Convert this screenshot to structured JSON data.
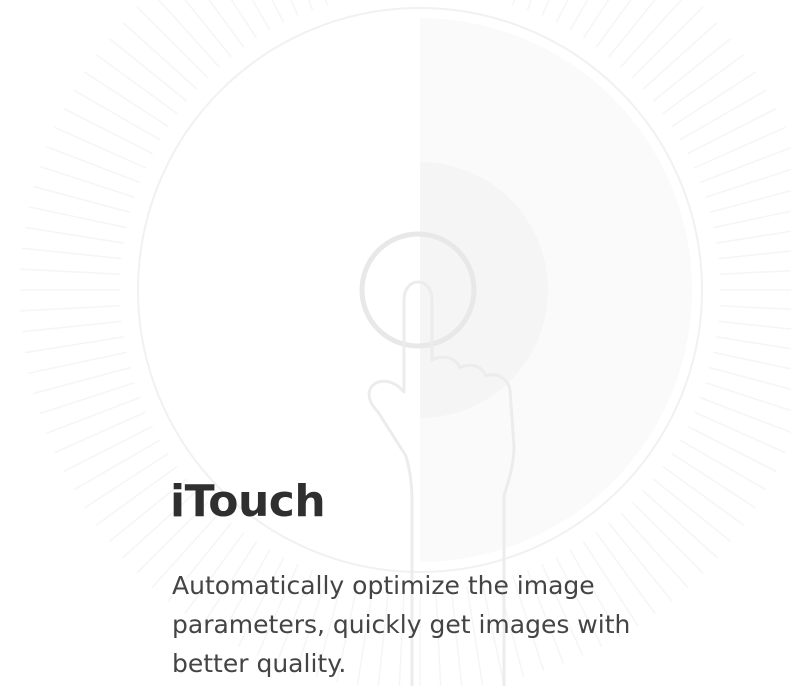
{
  "feature": {
    "title": "iTouch",
    "description": "Automatically optimize the image parameters, quickly get images with better quality."
  },
  "illustration": {
    "icon": "touch-gesture-icon",
    "line_color": "#ececec",
    "fill_color": "#f7f7f7"
  }
}
